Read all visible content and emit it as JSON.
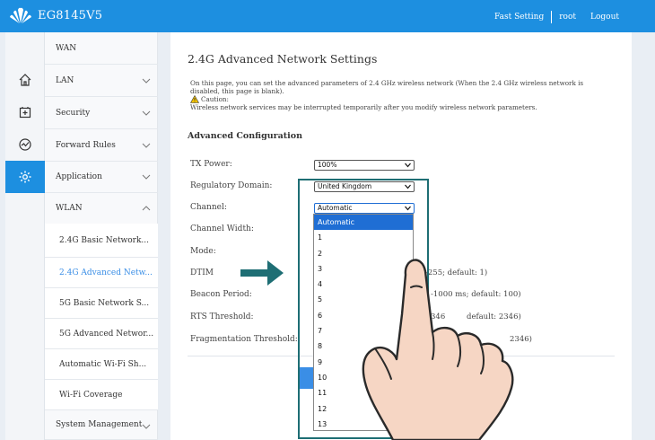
{
  "header": {
    "brand": "EG8145V5",
    "links": [
      "Fast Setting",
      "root",
      "Logout"
    ]
  },
  "rail_icons": [
    "home-icon",
    "plus-box-icon",
    "gauge-icon",
    "gear-icon"
  ],
  "sidebar": {
    "items": [
      {
        "label": "WAN",
        "chevron": false
      },
      {
        "label": "LAN",
        "chevron": "down"
      },
      {
        "label": "Security",
        "chevron": "down"
      },
      {
        "label": "Forward Rules",
        "chevron": "down"
      },
      {
        "label": "Application",
        "chevron": "down"
      },
      {
        "label": "WLAN",
        "chevron": "up"
      },
      {
        "label": "System Management",
        "chevron": "down"
      }
    ],
    "wlan_sub": [
      {
        "label": "2.4G Basic Network..."
      },
      {
        "label": "2.4G Advanced Netw..."
      },
      {
        "label": "5G Basic Network S..."
      },
      {
        "label": "5G Advanced Networ..."
      },
      {
        "label": "Automatic Wi-Fi Sh..."
      },
      {
        "label": "Wi-Fi Coverage"
      }
    ]
  },
  "page": {
    "title": "2.4G Advanced Network Settings",
    "description": "On this page, you can set the advanced parameters of 2.4 GHz wireless network (When the 2.4 GHz wireless network is disabled, this page is blank).",
    "caution_label": "Caution:",
    "caution_text": "Wireless network services may be interrupted temporarily after you modify wireless network parameters.",
    "section": "Advanced Configuration"
  },
  "form": {
    "tx_power": {
      "label": "TX Power:",
      "value": "100%"
    },
    "regulatory_domain": {
      "label": "Regulatory Domain:",
      "value": "United Kingdom"
    },
    "channel": {
      "label": "Channel:",
      "value": "Automatic"
    },
    "channel_width": {
      "label": "Channel Width:"
    },
    "mode": {
      "label": "Mode:"
    },
    "dtim": {
      "label": "DTIM",
      "hint": "-255; default: 1)"
    },
    "beacon": {
      "label": "Beacon Period:",
      "hint": "-1000 ms; default: 100)"
    },
    "rts": {
      "label": "RTS Threshold:",
      "hint_a": "346",
      "hint_b": "default: 2346)"
    },
    "frag": {
      "label": "Fragmentation Threshold:",
      "hint": "2346)"
    }
  },
  "channel_options": [
    "Automatic",
    "1",
    "2",
    "3",
    "4",
    "5",
    "6",
    "7",
    "8",
    "9",
    "10",
    "11",
    "12",
    "13"
  ],
  "colors": {
    "topbar": "#1d8fe0",
    "active": "#1d8fe0",
    "selected_option": "#1f6ed4",
    "highlight_box": "#1e6e74",
    "arrow": "#1e6e74"
  }
}
